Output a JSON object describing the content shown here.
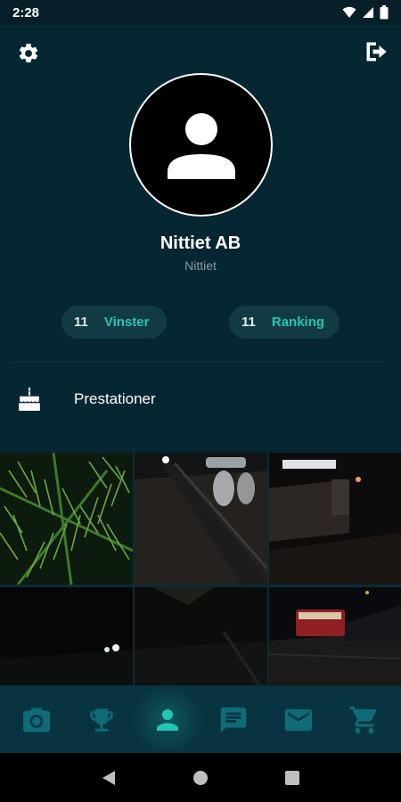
{
  "status_bar": {
    "time": "2:28"
  },
  "profile": {
    "name": "Nittiet AB",
    "username": "Nittiet"
  },
  "stats": {
    "wins": {
      "value": "11",
      "label": "Vinster"
    },
    "ranking": {
      "value": "11",
      "label": "Ranking"
    }
  },
  "achievements": {
    "label": "Prestationer"
  },
  "bottom_nav": {
    "items": [
      "camera-icon",
      "trophy-icon",
      "person-icon",
      "chat-icon",
      "mail-icon",
      "cart-icon"
    ],
    "active": "person-icon"
  },
  "colors": {
    "accent": "#21c7b3",
    "background": "#062632",
    "pill": "#123a45",
    "nav_icon": "#0f6b77"
  }
}
